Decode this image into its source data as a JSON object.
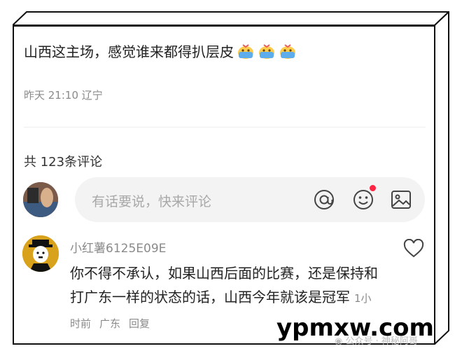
{
  "post": {
    "text": "山西这主场，感觉谁来都得扒层皮",
    "emoji_count": 3,
    "time": "昨天 21:10",
    "location": "辽宁"
  },
  "comments_header": {
    "count_label": "共 123条评论"
  },
  "comment_input": {
    "placeholder": "有话要说，快来评论"
  },
  "icons": {
    "mention": "at-icon",
    "emoji": "smiley-icon",
    "image": "image-icon",
    "like": "heart-icon"
  },
  "comment": {
    "username": "小红薯6125E09E",
    "text": "你不得不承认，如果山西后面的比赛，还是保持和打广东一样的状态的话，山西今年就该是冠军",
    "time": "1小时前",
    "location": "广东",
    "reply_label": "回复"
  },
  "watermark": {
    "site": "ypmxw.com",
    "account": "公众号 · 神秘阿哥"
  },
  "colors": {
    "notification_dot": "#ff2442",
    "secondary_text": "#8a8a8a"
  }
}
